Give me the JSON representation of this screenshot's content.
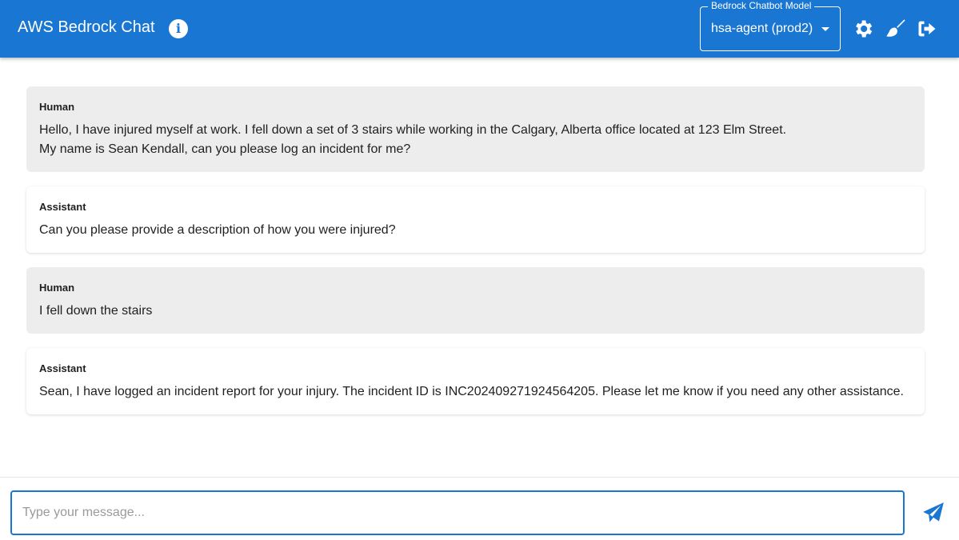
{
  "header": {
    "title": "AWS Bedrock Chat",
    "model_label": "Bedrock Chatbot Model",
    "model_value": "hsa-agent (prod2)"
  },
  "messages": [
    {
      "role": "Human",
      "text": "Hello, I have injured myself at work. I fell down a set of 3 stairs while working in the Calgary, Alberta office located at 123 Elm Street.\nMy name is Sean Kendall, can you please log an incident for me?"
    },
    {
      "role": "Assistant",
      "text": "Can you please provide a description of how you were injured?"
    },
    {
      "role": "Human",
      "text": "I fell down the stairs"
    },
    {
      "role": "Assistant",
      "text": "Sean, I have logged an incident report for your injury. The incident ID is INC202409271924564205. Please let me know if you need any other assistance."
    }
  ],
  "input": {
    "placeholder": "Type your message...",
    "value": ""
  },
  "colors": {
    "primary": "#1976d2",
    "human_bg": "#ededed"
  }
}
